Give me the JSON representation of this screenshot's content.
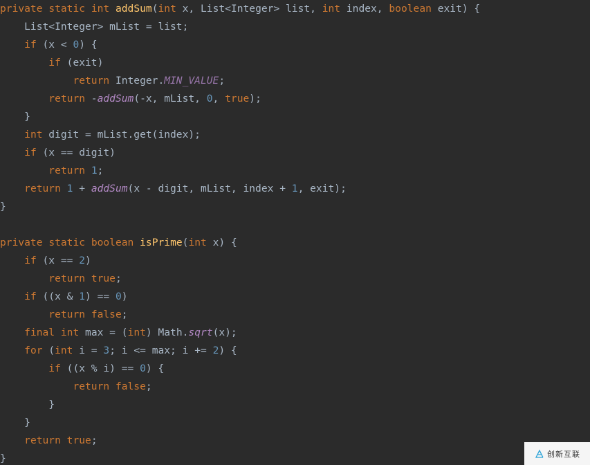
{
  "code": {
    "lines": [
      {
        "tokens": [
          {
            "t": "private",
            "c": "kw"
          },
          {
            "t": " ",
            "c": "op"
          },
          {
            "t": "static",
            "c": "kw"
          },
          {
            "t": " ",
            "c": "op"
          },
          {
            "t": "int",
            "c": "kw"
          },
          {
            "t": " ",
            "c": "op"
          },
          {
            "t": "addSum",
            "c": "fn-def"
          },
          {
            "t": "(",
            "c": "op"
          },
          {
            "t": "int",
            "c": "kw"
          },
          {
            "t": " x, List<Integer> list, ",
            "c": "op"
          },
          {
            "t": "int",
            "c": "kw"
          },
          {
            "t": " index, ",
            "c": "op"
          },
          {
            "t": "boolean",
            "c": "kw"
          },
          {
            "t": " exit) {",
            "c": "op"
          }
        ]
      },
      {
        "tokens": [
          {
            "t": "    List<Integer> mList = list;",
            "c": "op"
          }
        ]
      },
      {
        "tokens": [
          {
            "t": "    ",
            "c": "op"
          },
          {
            "t": "if",
            "c": "kw"
          },
          {
            "t": " (x < ",
            "c": "op"
          },
          {
            "t": "0",
            "c": "num"
          },
          {
            "t": ") {",
            "c": "op"
          }
        ]
      },
      {
        "tokens": [
          {
            "t": "        ",
            "c": "op"
          },
          {
            "t": "if",
            "c": "kw"
          },
          {
            "t": " (exit)",
            "c": "op"
          }
        ]
      },
      {
        "tokens": [
          {
            "t": "            ",
            "c": "op"
          },
          {
            "t": "return",
            "c": "kw"
          },
          {
            "t": " Integer.",
            "c": "op"
          },
          {
            "t": "MIN_VALUE",
            "c": "const"
          },
          {
            "t": ";",
            "c": "op"
          }
        ]
      },
      {
        "tokens": [
          {
            "t": "        ",
            "c": "op"
          },
          {
            "t": "return",
            "c": "kw"
          },
          {
            "t": " -",
            "c": "op"
          },
          {
            "t": "addSum",
            "c": "fn-call"
          },
          {
            "t": "(-x, mList, ",
            "c": "op"
          },
          {
            "t": "0",
            "c": "num"
          },
          {
            "t": ", ",
            "c": "op"
          },
          {
            "t": "true",
            "c": "kw"
          },
          {
            "t": ");",
            "c": "op"
          }
        ]
      },
      {
        "tokens": [
          {
            "t": "    }",
            "c": "op"
          }
        ]
      },
      {
        "tokens": [
          {
            "t": "    ",
            "c": "op"
          },
          {
            "t": "int",
            "c": "kw"
          },
          {
            "t": " digit = mList.get(index);",
            "c": "op"
          }
        ]
      },
      {
        "tokens": [
          {
            "t": "    ",
            "c": "op"
          },
          {
            "t": "if",
            "c": "kw"
          },
          {
            "t": " (x == digit)",
            "c": "op"
          }
        ]
      },
      {
        "tokens": [
          {
            "t": "        ",
            "c": "op"
          },
          {
            "t": "return",
            "c": "kw"
          },
          {
            "t": " ",
            "c": "op"
          },
          {
            "t": "1",
            "c": "num"
          },
          {
            "t": ";",
            "c": "op"
          }
        ]
      },
      {
        "tokens": [
          {
            "t": "    ",
            "c": "op"
          },
          {
            "t": "return",
            "c": "kw"
          },
          {
            "t": " ",
            "c": "op"
          },
          {
            "t": "1",
            "c": "num"
          },
          {
            "t": " + ",
            "c": "op"
          },
          {
            "t": "addSum",
            "c": "fn-call"
          },
          {
            "t": "(x - digit, mList, index + ",
            "c": "op"
          },
          {
            "t": "1",
            "c": "num"
          },
          {
            "t": ", exit);",
            "c": "op"
          }
        ]
      },
      {
        "tokens": [
          {
            "t": "}",
            "c": "op"
          }
        ]
      },
      {
        "tokens": [
          {
            "t": "",
            "c": "op"
          }
        ]
      },
      {
        "tokens": [
          {
            "t": "private",
            "c": "kw"
          },
          {
            "t": " ",
            "c": "op"
          },
          {
            "t": "static",
            "c": "kw"
          },
          {
            "t": " ",
            "c": "op"
          },
          {
            "t": "boolean",
            "c": "kw"
          },
          {
            "t": " ",
            "c": "op"
          },
          {
            "t": "isPrime",
            "c": "fn-def"
          },
          {
            "t": "(",
            "c": "op"
          },
          {
            "t": "int",
            "c": "kw"
          },
          {
            "t": " x) {",
            "c": "op"
          }
        ]
      },
      {
        "tokens": [
          {
            "t": "    ",
            "c": "op"
          },
          {
            "t": "if",
            "c": "kw"
          },
          {
            "t": " (x == ",
            "c": "op"
          },
          {
            "t": "2",
            "c": "num"
          },
          {
            "t": ")",
            "c": "op"
          }
        ]
      },
      {
        "tokens": [
          {
            "t": "        ",
            "c": "op"
          },
          {
            "t": "return",
            "c": "kw"
          },
          {
            "t": " ",
            "c": "op"
          },
          {
            "t": "true",
            "c": "kw"
          },
          {
            "t": ";",
            "c": "op"
          }
        ]
      },
      {
        "tokens": [
          {
            "t": "    ",
            "c": "op"
          },
          {
            "t": "if",
            "c": "kw"
          },
          {
            "t": " ((x & ",
            "c": "op"
          },
          {
            "t": "1",
            "c": "num"
          },
          {
            "t": ") == ",
            "c": "op"
          },
          {
            "t": "0",
            "c": "num"
          },
          {
            "t": ")",
            "c": "op"
          }
        ]
      },
      {
        "tokens": [
          {
            "t": "        ",
            "c": "op"
          },
          {
            "t": "return",
            "c": "kw"
          },
          {
            "t": " ",
            "c": "op"
          },
          {
            "t": "false",
            "c": "kw"
          },
          {
            "t": ";",
            "c": "op"
          }
        ]
      },
      {
        "tokens": [
          {
            "t": "    ",
            "c": "op"
          },
          {
            "t": "final",
            "c": "kw"
          },
          {
            "t": " ",
            "c": "op"
          },
          {
            "t": "int",
            "c": "kw"
          },
          {
            "t": " max = (",
            "c": "op"
          },
          {
            "t": "int",
            "c": "kw"
          },
          {
            "t": ") Math.",
            "c": "op"
          },
          {
            "t": "sqrt",
            "c": "fn-call"
          },
          {
            "t": "(x);",
            "c": "op"
          }
        ]
      },
      {
        "tokens": [
          {
            "t": "    ",
            "c": "op"
          },
          {
            "t": "for",
            "c": "kw"
          },
          {
            "t": " (",
            "c": "op"
          },
          {
            "t": "int",
            "c": "kw"
          },
          {
            "t": " i = ",
            "c": "op"
          },
          {
            "t": "3",
            "c": "num"
          },
          {
            "t": "; i <= max; i += ",
            "c": "op"
          },
          {
            "t": "2",
            "c": "num"
          },
          {
            "t": ") {",
            "c": "op"
          }
        ]
      },
      {
        "tokens": [
          {
            "t": "        ",
            "c": "op"
          },
          {
            "t": "if",
            "c": "kw"
          },
          {
            "t": " ((x % i) == ",
            "c": "op"
          },
          {
            "t": "0",
            "c": "num"
          },
          {
            "t": ") {",
            "c": "op"
          }
        ]
      },
      {
        "tokens": [
          {
            "t": "            ",
            "c": "op"
          },
          {
            "t": "return",
            "c": "kw"
          },
          {
            "t": " ",
            "c": "op"
          },
          {
            "t": "false",
            "c": "kw"
          },
          {
            "t": ";",
            "c": "op"
          }
        ]
      },
      {
        "tokens": [
          {
            "t": "        }",
            "c": "op"
          }
        ]
      },
      {
        "tokens": [
          {
            "t": "    }",
            "c": "op"
          }
        ]
      },
      {
        "tokens": [
          {
            "t": "    ",
            "c": "op"
          },
          {
            "t": "return",
            "c": "kw"
          },
          {
            "t": " ",
            "c": "op"
          },
          {
            "t": "true",
            "c": "kw"
          },
          {
            "t": ";",
            "c": "op"
          }
        ]
      },
      {
        "tokens": [
          {
            "t": "}",
            "c": "op"
          }
        ]
      }
    ]
  },
  "watermark": {
    "text": "创新互联"
  }
}
